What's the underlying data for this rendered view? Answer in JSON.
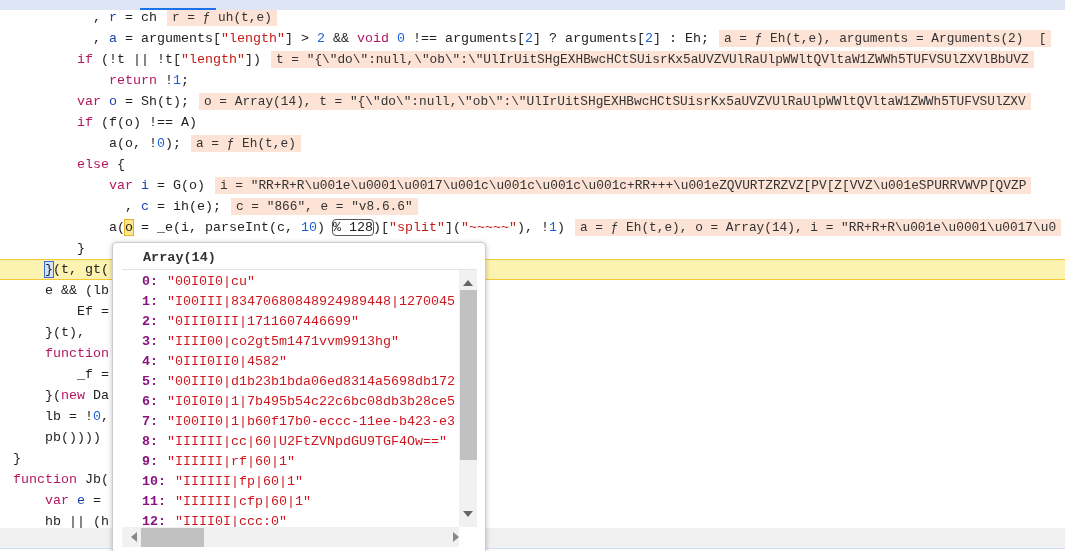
{
  "editor": {
    "lines": [
      {
        "current": false,
        "tokens": [
          {
            "text": "          ,",
            "kind": "plain"
          },
          {
            "text": " r",
            "kind": "var"
          },
          {
            "text": " = ch",
            "kind": "plain"
          }
        ],
        "annotation": "r = ƒ uh(t,e)"
      },
      {
        "current": false,
        "tokens": [
          {
            "text": "          ,",
            "kind": "plain"
          },
          {
            "text": " a",
            "kind": "var"
          },
          {
            "text": " = arguments[",
            "kind": "plain"
          },
          {
            "text": "\"length\"",
            "kind": "str"
          },
          {
            "text": "] > ",
            "kind": "plain"
          },
          {
            "text": "2",
            "kind": "num"
          },
          {
            "text": " && ",
            "kind": "plain"
          },
          {
            "text": "void",
            "kind": "kw"
          },
          {
            "text": " 0",
            "kind": "num"
          },
          {
            "text": " !== arguments[",
            "kind": "plain"
          },
          {
            "text": "2",
            "kind": "num"
          },
          {
            "text": "] ? arguments[",
            "kind": "plain"
          },
          {
            "text": "2",
            "kind": "num"
          },
          {
            "text": "] : Eh;",
            "kind": "plain"
          }
        ],
        "annotation": "a = ƒ Eh(t,e), arguments = Arguments(2)  ["
      },
      {
        "current": false,
        "tokens": [
          {
            "text": "        if",
            "kind": "kw"
          },
          {
            "text": " (!t || !t[",
            "kind": "plain"
          },
          {
            "text": "\"length\"",
            "kind": "str"
          },
          {
            "text": "])",
            "kind": "plain"
          }
        ],
        "annotation": "t = \"{\\\"do\\\":null,\\\"ob\\\":\\\"UlIrUitSHgEXHBwcHCtSUisrKx5aUVZVUlRaUlpWWltQVltaW1ZWWh5TUFVSUlZXVlBbUVZ"
      },
      {
        "current": false,
        "tokens": [
          {
            "text": "            return",
            "kind": "kw"
          },
          {
            "text": " !",
            "kind": "plain"
          },
          {
            "text": "1",
            "kind": "num"
          },
          {
            "text": ";",
            "kind": "plain"
          }
        ]
      },
      {
        "current": false,
        "tokens": [
          {
            "text": "        var",
            "kind": "kw"
          },
          {
            "text": " o",
            "kind": "var"
          },
          {
            "text": " = Sh(t);",
            "kind": "plain"
          }
        ],
        "annotation": "o = Array(14), t = \"{\\\"do\\\":null,\\\"ob\\\":\\\"UlIrUitSHgEXHBwcHCtSUisrKx5aUVZVUlRaUlpWWltQVltaW1ZWWh5TUFVSUlZXV"
      },
      {
        "current": false,
        "tokens": [
          {
            "text": "        if",
            "kind": "kw"
          },
          {
            "text": " (f(o) !== A)",
            "kind": "plain"
          }
        ]
      },
      {
        "current": false,
        "tokens": [
          {
            "text": "            a(o, !",
            "kind": "plain"
          },
          {
            "text": "0",
            "kind": "num"
          },
          {
            "text": ");",
            "kind": "plain"
          }
        ],
        "annotation": "a = ƒ Eh(t,e)"
      },
      {
        "current": false,
        "tokens": [
          {
            "text": "        else",
            "kind": "kw"
          },
          {
            "text": " {",
            "kind": "plain"
          }
        ]
      },
      {
        "current": false,
        "tokens": [
          {
            "text": "            var",
            "kind": "kw"
          },
          {
            "text": " i",
            "kind": "var"
          },
          {
            "text": " = G(o)",
            "kind": "plain"
          }
        ],
        "annotation": "i = \"RR+R+R\\u001e\\u0001\\u0017\\u001c\\u001c\\u001c\\u001c+RR+++\\u001eZQVURTZRZVZ[PV[Z[VVZ\\u001eSPURRVWVP[QVZP"
      },
      {
        "current": false,
        "tokens": [
          {
            "text": "              ,",
            "kind": "plain"
          },
          {
            "text": " c",
            "kind": "var"
          },
          {
            "text": " = ih(e);",
            "kind": "plain"
          }
        ],
        "annotation": "c = \"866\", e = \"v8.6.6\""
      },
      {
        "current": false,
        "tokens": [
          {
            "text": "            a(",
            "kind": "plain"
          },
          {
            "text": "o",
            "kind": "hover"
          },
          {
            "text": " = _e(i, parseInt(c, ",
            "kind": "plain"
          },
          {
            "text": "10",
            "kind": "num"
          },
          {
            "text": ") ",
            "kind": "plain"
          },
          {
            "text": "% 128",
            "kind": "boxed"
          },
          {
            "text": ")[",
            "kind": "plain"
          },
          {
            "text": "\"split\"",
            "kind": "str"
          },
          {
            "text": "](",
            "kind": "plain"
          },
          {
            "text": "\"~~~~~\"",
            "kind": "str"
          },
          {
            "text": "), !",
            "kind": "plain"
          },
          {
            "text": "1",
            "kind": "num"
          },
          {
            "text": ")",
            "kind": "plain"
          }
        ],
        "annotation": "a = ƒ Eh(t,e), o = Array(14), i = \"RR+R+R\\u001e\\u0001\\u0017\\u0"
      },
      {
        "current": false,
        "tokens": [
          {
            "text": "        }",
            "kind": "plain"
          }
        ]
      },
      {
        "current": true,
        "tokens": [
          {
            "text": "    }",
            "kind": "cursor"
          },
          {
            "text": "(t, gt(",
            "kind": "plain"
          }
        ]
      },
      {
        "current": false,
        "tokens": [
          {
            "text": "    e && (lb",
            "kind": "plain"
          }
        ]
      },
      {
        "current": false,
        "tokens": [
          {
            "text": "        Ef =",
            "kind": "plain"
          }
        ]
      },
      {
        "current": false,
        "tokens": [
          {
            "text": "    }(t),",
            "kind": "plain"
          }
        ]
      },
      {
        "current": false,
        "tokens": [
          {
            "text": "    function",
            "kind": "kw"
          }
        ]
      },
      {
        "current": false,
        "tokens": [
          {
            "text": "        _f =",
            "kind": "plain"
          }
        ]
      },
      {
        "current": false,
        "tokens": [
          {
            "text": "    }(",
            "kind": "plain"
          },
          {
            "text": "new",
            "kind": "kw"
          },
          {
            "text": " Da",
            "kind": "plain"
          }
        ]
      },
      {
        "current": false,
        "tokens": [
          {
            "text": "    lb = !",
            "kind": "plain"
          },
          {
            "text": "0",
            "kind": "num"
          },
          {
            "text": ",",
            "kind": "plain"
          }
        ]
      },
      {
        "current": false,
        "tokens": [
          {
            "text": "    pb())))",
            "kind": "plain"
          }
        ]
      },
      {
        "current": false,
        "tokens": [
          {
            "text": "}",
            "kind": "plain"
          }
        ]
      },
      {
        "current": false,
        "tokens": [
          {
            "text": "function",
            "kind": "kw"
          },
          {
            "text": " Jb(",
            "kind": "plain"
          }
        ]
      },
      {
        "current": false,
        "tokens": [
          {
            "text": "    var",
            "kind": "kw"
          },
          {
            "text": " e",
            "kind": "var"
          },
          {
            "text": " =",
            "kind": "plain"
          }
        ]
      },
      {
        "current": false,
        "tokens": [
          {
            "text": "    hb || (h",
            "kind": "plain"
          }
        ]
      }
    ]
  },
  "popup": {
    "title": "Array(14)",
    "entries": [
      {
        "key": "0:",
        "value": "\"00I0I0|cu\""
      },
      {
        "key": "1:",
        "value": "\"I00III|83470680848924989448|1270045"
      },
      {
        "key": "2:",
        "value": "\"0III0III|1711607446699\""
      },
      {
        "key": "3:",
        "value": "\"IIII00|co2gt5m1471vvm9913hg\""
      },
      {
        "key": "4:",
        "value": "\"0III0II0|4582\""
      },
      {
        "key": "5:",
        "value": "\"00III0|d1b23b1bda06ed8314a5698db172"
      },
      {
        "key": "6:",
        "value": "\"I0I0I0|1|7b495b54c22c6bc08db3b28ce5"
      },
      {
        "key": "7:",
        "value": "\"I00II0|1|b60f17b0-eccc-11ee-b423-e3"
      },
      {
        "key": "8:",
        "value": "\"IIIIII|cc|60|U2FtZVNpdGU9TGF4Ow==\""
      },
      {
        "key": "9:",
        "value": "\"IIIIII|rf|60|1\""
      },
      {
        "key": "10:",
        "value": "\"IIIIII|fp|60|1\""
      },
      {
        "key": "11:",
        "value": "\"IIIIII|cfp|60|1\""
      },
      {
        "key": "12:",
        "value": "\"IIII0I|ccc:0\""
      }
    ]
  }
}
